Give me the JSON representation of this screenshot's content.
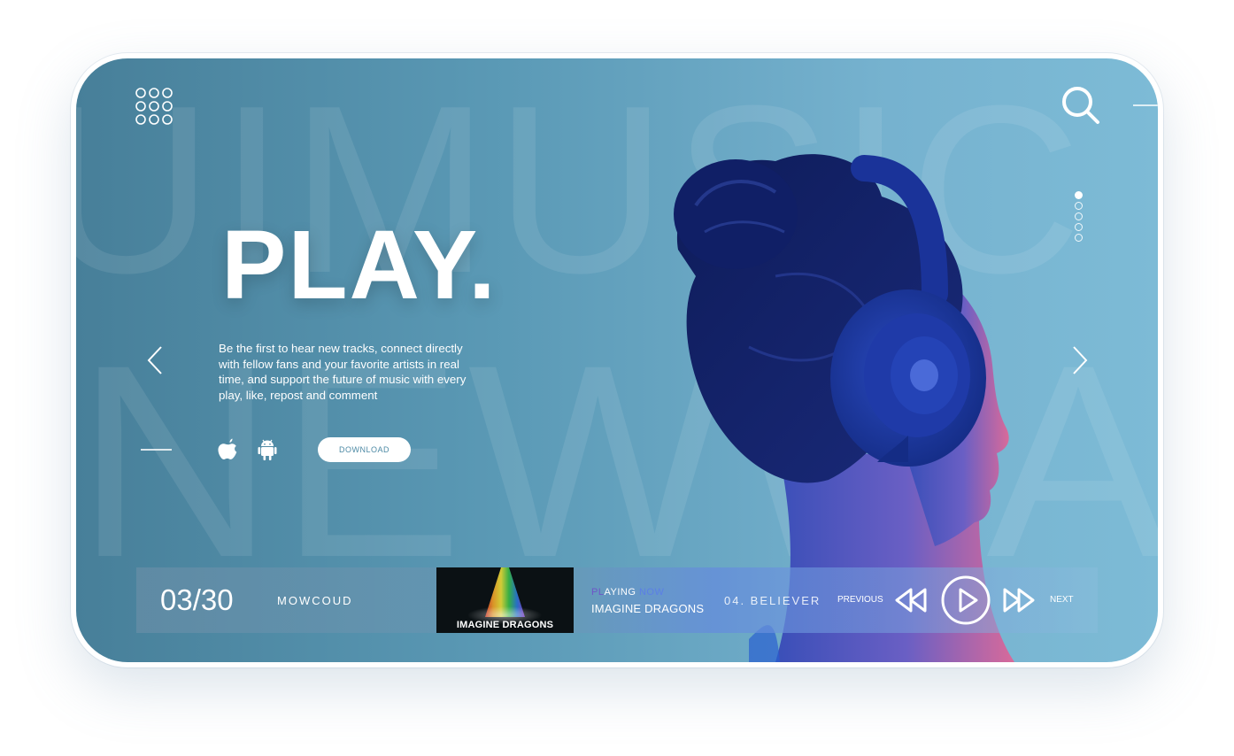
{
  "background": {
    "line1": "UIMUSIC",
    "line2": "NEWWAY"
  },
  "hero": {
    "title": "PLAY.",
    "description": "Be the first to hear new tracks, connect directly with fellow fans and your favorite artists in real time, and support the future of music with every play, like, repost and comment",
    "download_label": "DOWNLOAD"
  },
  "icons": {
    "menu": "grid-menu-icon",
    "search": "search-icon",
    "prev_slide": "chevron-left-icon",
    "next_slide": "chevron-right-icon",
    "apple": "apple-icon",
    "android": "android-icon",
    "rewind": "rewind-icon",
    "play": "play-icon",
    "fast_forward": "fast-forward-icon"
  },
  "slides": {
    "count": 5,
    "active_index": 0
  },
  "player": {
    "track_count": "03/30",
    "brand": "MOWCOUD",
    "album_text": "IMAGINE DRAGONS",
    "playing_label_pl": "PL",
    "playing_label_mid": "AYING ",
    "playing_label_now": "NOW",
    "artist": "IMAGINE DRAGONS",
    "song": "04. BELIEVER",
    "previous_label": "PREVIOUS",
    "next_label": "NEXT"
  },
  "colors": {
    "bg_start": "#477f99",
    "bg_end": "#7dbbd6",
    "accent_blue": "#1b3fa8",
    "white": "#ffffff"
  }
}
